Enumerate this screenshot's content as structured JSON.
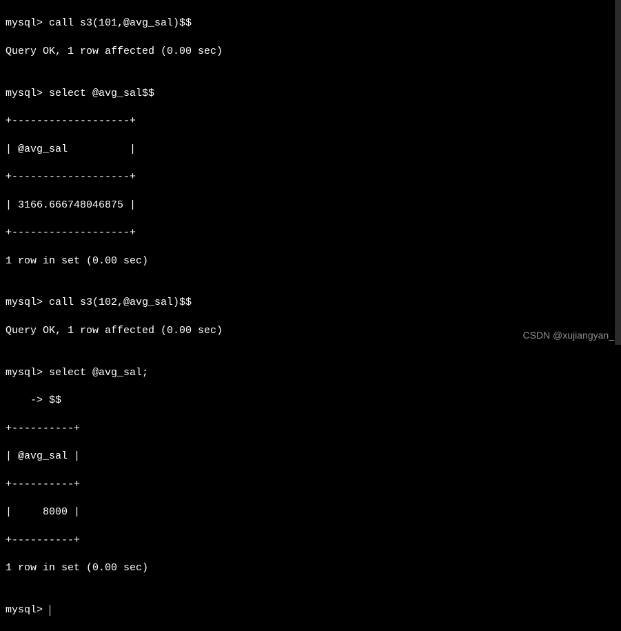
{
  "prompt": "mysql> ",
  "cont_prompt": "    -> ",
  "cmd1": "call s3(101,@avg_sal)$$",
  "resp1": "Query OK, 1 row affected (0.00 sec)",
  "blank": "",
  "cmd2": "select @avg_sal$$",
  "table1": {
    "border": "+-------------------+",
    "header": "| @avg_sal          |",
    "row": "| 3166.666748046875 |"
  },
  "resp2": "1 row in set (0.00 sec)",
  "cmd3": "call s3(102,@avg_sal)$$",
  "resp3": "Query OK, 1 row affected (0.00 sec)",
  "cmd4": "select @avg_sal;",
  "cmd4b": "$$",
  "table2": {
    "border": "+----------+",
    "header": "| @avg_sal |",
    "row": "|     8000 |"
  },
  "resp4": "1 row in set (0.00 sec)",
  "watermark": "CSDN @xujiangyan_"
}
